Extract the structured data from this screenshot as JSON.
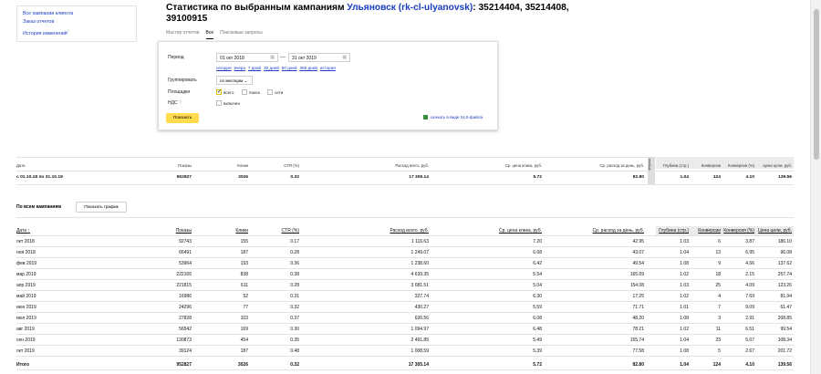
{
  "left_nav": {
    "items": [
      "Все кампании клиента",
      "Заказ отчетов",
      "История изменений"
    ],
    "history_sup": "?"
  },
  "title": {
    "prefix": "Статистика по выбранным кампаниям",
    "campaign": "Ульяновск (rk-cl-ulyanovsk)",
    "ids": ": 35214404, 35214408, 39100915"
  },
  "tabs": [
    "Мастер отчетов",
    "Все",
    "Поисковые запросы"
  ],
  "form": {
    "period_label": "Период",
    "date_from": "01 окт 2018",
    "date_to": "31 окт 2019",
    "date_dash": "—",
    "calendar_glyph": "▦",
    "presets": [
      "сегодня",
      "вчера",
      "7 дней",
      "30 дней",
      "90 дней",
      "365 дней",
      "история"
    ],
    "group_label": "Группировать",
    "group_value": "по месяцам",
    "platforms_label": "Площадки",
    "platform_all": "всего",
    "platform_search": "поиск",
    "platform_net": "сети",
    "vat_label": "НДС",
    "vat_hint": "?",
    "vat_option": "включен",
    "show_button": "Показать",
    "xls_link": "скачать в виде XLS-файла"
  },
  "summary": {
    "headers": [
      "Дата",
      "Показы",
      "Клики",
      "CTR (%)",
      "Расход всего, руб.",
      "Ср. цена клика, руб.",
      "Ср. расход за день, руб."
    ],
    "vertical_header": "Метрика",
    "metrika_headers": [
      "Глубина (стр.)",
      "Конверсии",
      "Конверсия (%)",
      "Цена цели, руб."
    ],
    "row": [
      "с 01.10.18 по 31.10.19",
      "952827",
      "3026",
      "0.32",
      "17 305.14",
      "5.72",
      "82.80",
      "1.04",
      "124",
      "4.10",
      "139.56"
    ]
  },
  "all_campaigns": {
    "label": "По всем кампаниям",
    "graph_button": "Показать график",
    "headers": [
      "Дата",
      "Показы",
      "Клики",
      "CTR (%)",
      "Расход всего, руб.",
      "Ср. цена клика, руб.",
      "Ср. расход за день, руб.",
      "Глубина (стр.)",
      "Конверсии",
      "Конверсия (%)",
      "Цена цели, руб."
    ],
    "sort_mark": "↑",
    "rows": [
      [
        "окт 2018",
        "92743",
        "155",
        "0.17",
        "1 116.63",
        "7.20",
        "42.95",
        "1.03",
        "6",
        "3.87",
        "186.10"
      ],
      [
        "ноя 2018",
        "66491",
        "187",
        "0.28",
        "1 249.07",
        "6.68",
        "43.07",
        "1.04",
        "13",
        "6.95",
        "96.08"
      ],
      [
        "фев 2019",
        "53964",
        "193",
        "0.36",
        "1 238.60",
        "6.42",
        "49.54",
        "1.08",
        "9",
        "4.66",
        "137.62"
      ],
      [
        "мар 2019",
        "222165",
        "838",
        "0.38",
        "4 639.35",
        "5.54",
        "165.69",
        "1.02",
        "18",
        "2.15",
        "257.74"
      ],
      [
        "апр 2019",
        "221815",
        "611",
        "0.28",
        "3 081.51",
        "5.04",
        "154.08",
        "1.03",
        "25",
        "4.09",
        "123.26"
      ],
      [
        "май 2019",
        "16986",
        "52",
        "0.31",
        "327.74",
        "6.30",
        "17.25",
        "1.02",
        "4",
        "7.69",
        "81.94"
      ],
      [
        "июн 2019",
        "24296",
        "77",
        "0.32",
        "430.27",
        "5.59",
        "71.71",
        "1.01",
        "7",
        "9.09",
        "61.47"
      ],
      [
        "июл 2019",
        "27828",
        "103",
        "0.37",
        "626.56",
        "6.08",
        "48.20",
        "1.08",
        "3",
        "2.91",
        "208.85"
      ],
      [
        "авг 2019",
        "56542",
        "169",
        "0.30",
        "1 094.97",
        "6.48",
        "78.21",
        "1.02",
        "11",
        "6.51",
        "99.54"
      ],
      [
        "сен 2019",
        "130873",
        "454",
        "0.35",
        "2 491.85",
        "5.49",
        "155.74",
        "1.04",
        "23",
        "5.07",
        "108.34"
      ],
      [
        "окт 2019",
        "39124",
        "187",
        "0.48",
        "1 008.59",
        "5.39",
        "77.58",
        "1.08",
        "5",
        "2.67",
        "201.72"
      ]
    ],
    "total": [
      "Итого",
      "952827",
      "3026",
      "0.32",
      "17 305.14",
      "5.72",
      "82.80",
      "1.04",
      "124",
      "4.10",
      "139.56"
    ]
  }
}
